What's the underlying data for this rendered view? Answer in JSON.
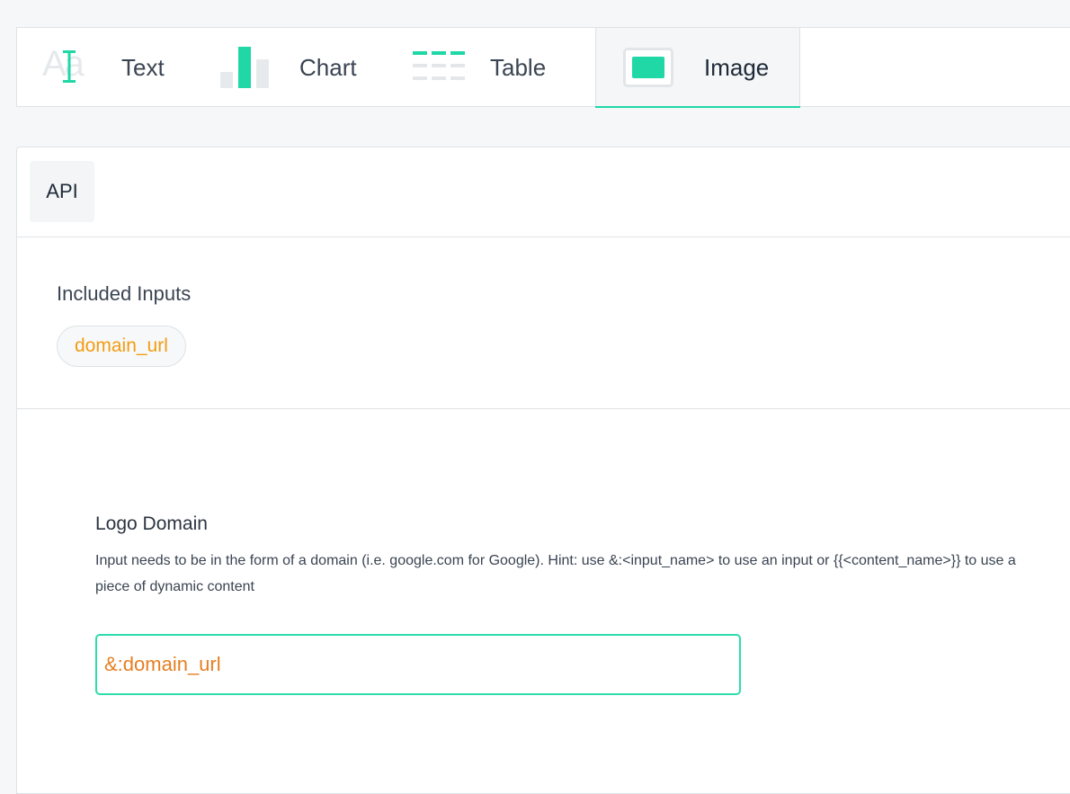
{
  "tabs": [
    {
      "label": "Text",
      "icon": "text-icon"
    },
    {
      "label": "Chart",
      "icon": "chart-icon"
    },
    {
      "label": "Table",
      "icon": "table-icon"
    },
    {
      "label": "Image",
      "icon": "image-icon",
      "active": true
    }
  ],
  "subtabs": {
    "api_label": "API"
  },
  "included_inputs": {
    "title": "Included Inputs",
    "chips": [
      "domain_url"
    ]
  },
  "logo_domain": {
    "title": "Logo Domain",
    "hint": "Input needs to be in the form of a domain (i.e. google.com for Google). Hint: use &:<input_name> to use an input or {{<content_name>}} to use a piece of dynamic content",
    "value": "&:domain_url"
  },
  "colors": {
    "accent": "#1fd8a6",
    "chip_text": "#f39c12",
    "input_value": "#e67e22"
  }
}
